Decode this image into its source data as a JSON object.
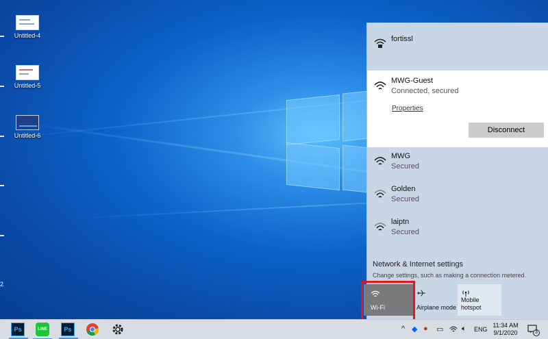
{
  "desktop": {
    "icons": [
      {
        "label": "Untitled-4"
      },
      {
        "label": "Untitled-5"
      },
      {
        "label": "Untitled-6"
      }
    ],
    "edge_label": "2"
  },
  "network_flyout": {
    "top_network": {
      "name": "fortissl"
    },
    "connected_network": {
      "name": "MWG-Guest",
      "status": "Connected, secured",
      "properties_label": "Properties",
      "disconnect_label": "Disconnect"
    },
    "networks": [
      {
        "name": "MWG",
        "status": "Secured"
      },
      {
        "name": "Golden",
        "status": "Secured"
      },
      {
        "name": "laiptn",
        "status": "Secured"
      }
    ],
    "settings_title": "Network & Internet settings",
    "settings_subtitle": "Change settings, such as making a connection metered.",
    "quick_actions": [
      {
        "label": "Wi-Fi",
        "icon": "wifi-icon",
        "active": true
      },
      {
        "label": "Airplane mode",
        "icon": "airplane-icon"
      },
      {
        "label": "Mobile hotspot",
        "icon": "hotspot-icon"
      }
    ]
  },
  "taskbar": {
    "apps": [
      {
        "name": "Photoshop",
        "icon_text": "Ps"
      },
      {
        "name": "LINE",
        "icon_text": "LINE"
      },
      {
        "name": "Photoshop",
        "icon_text": "Ps"
      },
      {
        "name": "Chrome"
      },
      {
        "name": "Settings"
      }
    ],
    "tray": {
      "language": "ENG",
      "time": "11:34 AM",
      "date": "9/1/2020",
      "notification_count": "3"
    }
  },
  "colors": {
    "flyout_bg": "#c9d6e6",
    "wifi_tile_active": "#7a7a7a",
    "highlight": "#e8141c",
    "taskbar_bg": "#d8dde3"
  }
}
